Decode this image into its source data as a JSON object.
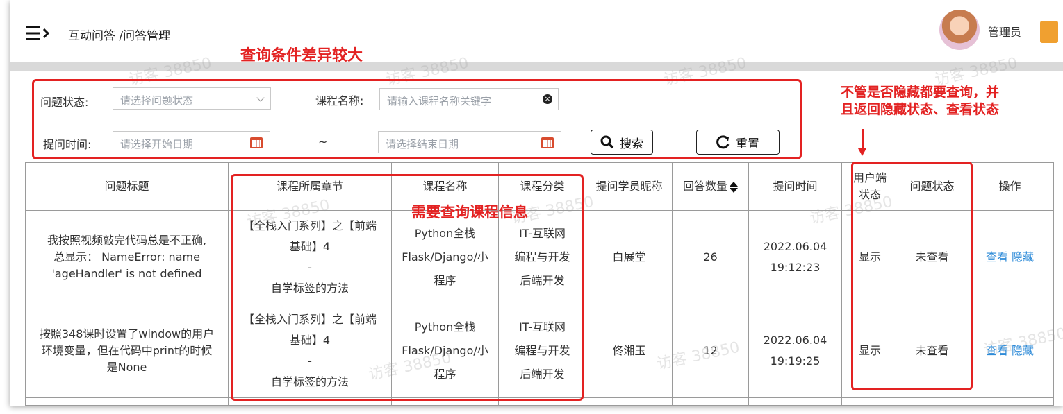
{
  "header": {
    "breadcrumb": "互动问答 /问答管理",
    "user_name": "管理员"
  },
  "filters": {
    "status_label": "问题状态:",
    "status_placeholder": "请选择问题状态",
    "course_label": "课程名称:",
    "course_placeholder": "请输入课程名称关键字",
    "time_label": "提问时间:",
    "start_placeholder": "请选择开始日期",
    "range_separator": "~",
    "end_placeholder": "请选择结束日期",
    "search_label": "搜索",
    "reset_label": "重置"
  },
  "table": {
    "columns": [
      "问题标题",
      "课程所属章节",
      "课程名称",
      "课程分类",
      "提问学员昵称",
      "回答数量",
      "用户端\n状态",
      "问题状态",
      "操作",
      "提问时间"
    ],
    "headers": {
      "title": "问题标题",
      "chapter": "课程所属章节",
      "course": "课程名称",
      "category": "课程分类",
      "student": "提问学员昵称",
      "answers": "回答数量",
      "time": "提问时间",
      "user_status_line1": "用户端",
      "user_status_line2": "状态",
      "question_status": "问题状态",
      "actions": "操作"
    },
    "rows": [
      {
        "title_lines": [
          "我按照视频敲完代码总是不正确,",
          "总显示： NameError: name",
          "'ageHandler' is not defined"
        ],
        "chapter_lines": [
          "【全栈入门系列】之【前端",
          "基础】4",
          "-",
          "自学标签的方法"
        ],
        "course_lines": [
          "Python全栈",
          "Flask/Django/小",
          "程序"
        ],
        "category_lines": [
          "IT-互联网",
          "编程与开发",
          "后端开发"
        ],
        "student": "白展堂",
        "answers": "26",
        "date": "2022.06.04",
        "time": "19:12:23",
        "user_status": "显示",
        "question_status": "未查看",
        "view": "查看",
        "hide": "隐藏"
      },
      {
        "title_lines": [
          "按照348课时设置了window的用户",
          "环境变量，但在代码中print的时候",
          "是None"
        ],
        "chapter_lines": [
          "【全栈入门系列】之【前端",
          "基础】4",
          "-",
          "自学标签的方法"
        ],
        "course_lines": [
          "Python全栈",
          "Flask/Django/小",
          "程序"
        ],
        "category_lines": [
          "IT-互联网",
          "编程与开发",
          "后端开发"
        ],
        "student": "佟湘玉",
        "answers": "12",
        "date": "2022.06.04",
        "time": "19:19:25",
        "user_status": "显示",
        "question_status": "未查看",
        "view": "查看",
        "hide": "隐藏"
      }
    ]
  },
  "annotations": {
    "query_note": "查询条件差异较大",
    "hidden_note_line1": "不管是否隐藏都要查询，并",
    "hidden_note_line2": "且返回隐藏状态、查看状态",
    "course_note": "需要查询课程信息"
  },
  "watermark": "访客 38850",
  "colors": {
    "annotation_red": "#e32222",
    "link_blue": "#2e8bd8",
    "calendar_red": "#d84c2f"
  }
}
